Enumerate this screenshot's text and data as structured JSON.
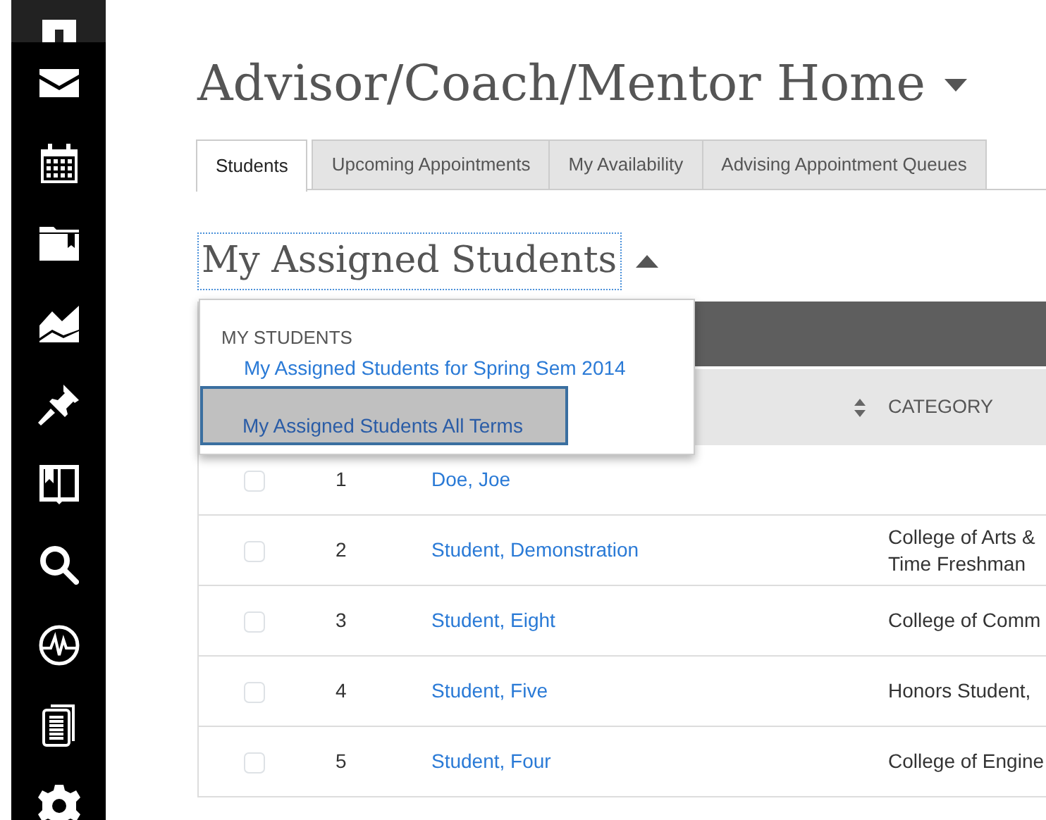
{
  "sidebar": {
    "items": [
      {
        "kind": "home",
        "selected": true
      },
      {
        "kind": "mail",
        "selected": false
      },
      {
        "kind": "calendar",
        "selected": false
      },
      {
        "kind": "folder",
        "selected": false
      },
      {
        "kind": "chart",
        "selected": false
      },
      {
        "kind": "pin",
        "selected": false
      },
      {
        "kind": "book",
        "selected": false
      },
      {
        "kind": "search",
        "selected": false
      },
      {
        "kind": "pulse",
        "selected": false
      },
      {
        "kind": "documents",
        "selected": false
      },
      {
        "kind": "gear",
        "selected": false
      }
    ]
  },
  "page_title": "Advisor/Coach/Mentor Home",
  "tabs": [
    {
      "label": "Students",
      "selected": true
    },
    {
      "label": "Upcoming Appointments",
      "selected": false
    },
    {
      "label": "My Availability",
      "selected": false
    },
    {
      "label": "Advising Appointment Queues",
      "selected": false
    }
  ],
  "list_heading": "My Assigned Students",
  "dropdown": {
    "header": "MY STUDENTS",
    "items": [
      {
        "label": "My Assigned Students for Spring Sem 2014",
        "selected": false
      },
      {
        "label": "My Assigned Students All Terms",
        "selected": true
      }
    ]
  },
  "table": {
    "columns": [
      "CATEGORY"
    ],
    "rows": [
      {
        "checked": false,
        "number": "1",
        "name": "Doe, Joe",
        "category_lines": []
      },
      {
        "checked": false,
        "number": "2",
        "name": "Student, Demonstration",
        "category_lines": [
          "College of Arts &",
          "Time Freshman"
        ]
      },
      {
        "checked": false,
        "number": "3",
        "name": "Student, Eight",
        "category_lines": [
          "College of Comm"
        ]
      },
      {
        "checked": false,
        "number": "4",
        "name": "Student, Five",
        "category_lines": [
          "Honors Student,"
        ]
      },
      {
        "checked": false,
        "number": "5",
        "name": "Student, Four",
        "category_lines": [
          "College of Engine"
        ]
      }
    ]
  }
}
